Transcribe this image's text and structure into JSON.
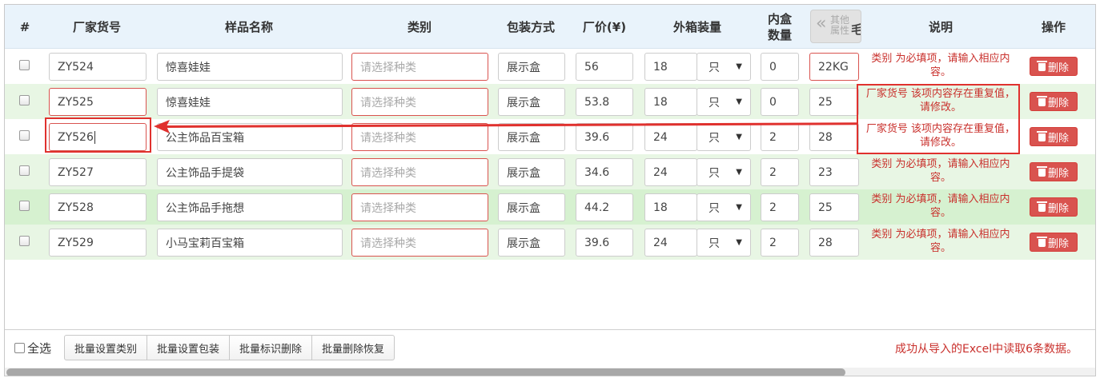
{
  "columns": {
    "index": "#",
    "sku": "厂家货号",
    "name": "样品名称",
    "category": "类别",
    "packaging": "包装方式",
    "price": "厂价(¥)",
    "carton": "外箱装量",
    "inner_line1": "内盒",
    "inner_line2": "数量",
    "other_attr_line1": "其他",
    "other_attr_line2": "属性",
    "weight_cut": "毛/",
    "desc": "说明",
    "action": "操作"
  },
  "collapse_glyph": "«",
  "category_placeholder": "请选择种类",
  "delete_label": "删除",
  "rows": [
    {
      "sku": "ZY524",
      "name": "惊喜娃娃",
      "pack": "展示盒",
      "price": "56",
      "carton": "18",
      "unit": "只",
      "inner": "0",
      "weight": "22KG",
      "msg": "类别 为必填项，请输入相应内容。"
    },
    {
      "sku": "ZY525",
      "name": "惊喜娃娃",
      "pack": "展示盒",
      "price": "53.8",
      "carton": "18",
      "unit": "只",
      "inner": "0",
      "weight": "25",
      "msg": "厂家货号 该项内容存在重复值，请修改。"
    },
    {
      "sku": "ZY526",
      "name": "公主饰品百宝箱",
      "pack": "展示盒",
      "price": "39.6",
      "carton": "24",
      "unit": "只",
      "inner": "2",
      "weight": "28",
      "msg": "厂家货号 该项内容存在重复值，请修改。"
    },
    {
      "sku": "ZY527",
      "name": "公主饰品手提袋",
      "pack": "展示盒",
      "price": "34.6",
      "carton": "24",
      "unit": "只",
      "inner": "2",
      "weight": "23",
      "msg": "类别 为必填项，请输入相应内容。"
    },
    {
      "sku": "ZY528",
      "name": "公主饰品手拖想",
      "pack": "展示盒",
      "price": "44.2",
      "carton": "18",
      "unit": "只",
      "inner": "2",
      "weight": "25",
      "msg": "类别 为必填项，请输入相应内容。"
    },
    {
      "sku": "ZY529",
      "name": "小马宝莉百宝箱",
      "pack": "展示盒",
      "price": "39.6",
      "carton": "24",
      "unit": "只",
      "inner": "2",
      "weight": "28",
      "msg": "类别 为必填项，请输入相应内容。"
    }
  ],
  "footer": {
    "select_all": "全选",
    "buttons": [
      "批量设置类别",
      "批量设置包装",
      "批量标识删除",
      "批量删除恢复"
    ],
    "status": "成功从导入的Excel中读取6条数据。"
  },
  "colors": {
    "error_red": "#c9302c",
    "header_bg": "#e9f3fb",
    "row_green": "#e8f6e4",
    "delete_button": "#d9534f"
  }
}
